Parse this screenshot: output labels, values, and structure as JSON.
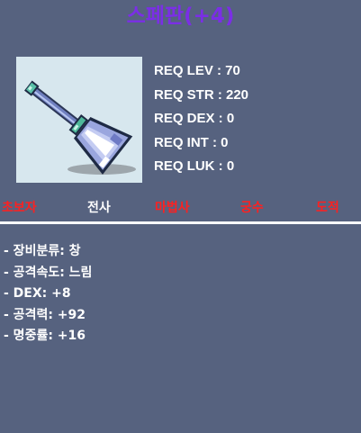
{
  "item": {
    "name": "스페판(+4)",
    "name_color": "#7b2ee6",
    "icon": "spear-weapon-icon"
  },
  "requirements": [
    {
      "label": "REQ LEV : 70"
    },
    {
      "label": "REQ STR : 220"
    },
    {
      "label": "REQ DEX : 0"
    },
    {
      "label": "REQ INT : 0"
    },
    {
      "label": "REQ LUK : 0"
    }
  ],
  "jobs": [
    {
      "label": "초보자",
      "color": "#ff2020"
    },
    {
      "label": "전사",
      "color": "#ffffff"
    },
    {
      "label": "마법사",
      "color": "#ff2020"
    },
    {
      "label": "궁수",
      "color": "#ff2020"
    },
    {
      "label": "도적",
      "color": "#ff2020"
    }
  ],
  "stats": [
    {
      "label": "- 장비분류: 창"
    },
    {
      "label": "- 공격속도: 느림"
    },
    {
      "label": "- DEX: +8"
    },
    {
      "label": "- 공격력: +92"
    },
    {
      "label": "- 명중률: +16"
    }
  ],
  "colors": {
    "background": "#56627f",
    "icon_background": "#d7e7ee"
  }
}
